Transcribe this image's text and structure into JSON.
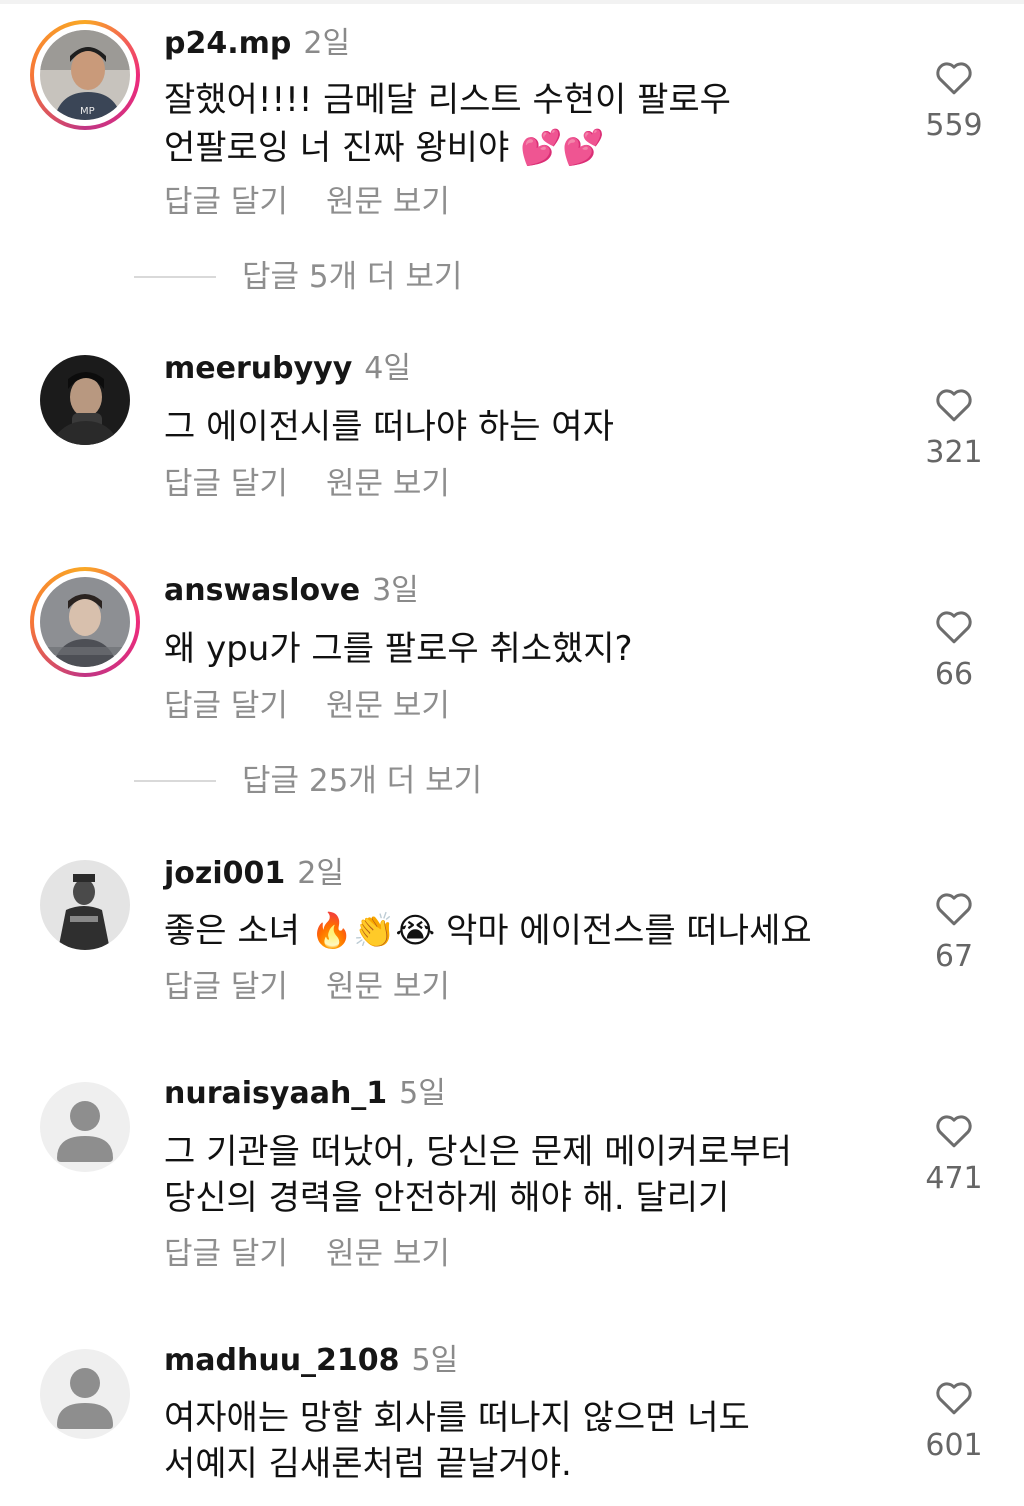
{
  "comments": [
    {
      "username": "p24.mp",
      "time": "2일",
      "lines": [
        "잘했어!!!! 금메달 리스트 수현이 팔로우",
        "언팔로잉 너 진짜 왕비야 💕💕"
      ],
      "likes": "559",
      "reply": "답글 달기",
      "see_original": "원문 보기",
      "more_replies": "답글 5개 더 보기",
      "avatar": "photo-person-ring"
    },
    {
      "username": "meerubyyy",
      "time": "4일",
      "lines": [
        "그 에이전시를 떠나야 하는 여자"
      ],
      "likes": "321",
      "reply": "답글 달기",
      "see_original": "원문 보기",
      "avatar": "photo-dark"
    },
    {
      "username": "answaslove",
      "time": "3일",
      "lines": [
        "왜 ypu가 그를 팔로우 취소했지?"
      ],
      "likes": "66",
      "reply": "답글 달기",
      "see_original": "원문 보기",
      "more_replies": "답글 25개 더 보기",
      "avatar": "photo-person-ring"
    },
    {
      "username": "jozi001",
      "time": "2일",
      "lines": [
        "좋은 소녀 🔥👏😭 악마 에이전스를 떠나세요"
      ],
      "likes": "67",
      "reply": "답글 달기",
      "see_original": "원문 보기",
      "avatar": "photo-grayscale"
    },
    {
      "username": "nuraisyaah_1",
      "time": "5일",
      "lines": [
        "그 기관을 떠났어, 당신은 문제 메이커로부터",
        "당신의 경력을 안전하게 해야 해. 달리기"
      ],
      "likes": "471",
      "reply": "답글 달기",
      "see_original": "원문 보기",
      "avatar": "default-user-icon"
    },
    {
      "username": "madhuu_2108",
      "time": "5일",
      "lines": [
        "여자애는 망할 회사를 떠나지 않으면 너도",
        "서예지 김새론처럼 끝날거야."
      ],
      "likes": "601",
      "avatar": "default-user-icon"
    }
  ],
  "colors": {
    "username": "#161616",
    "meta": "#8e8e8e",
    "text": "#111111",
    "ring_start": "#f9a825",
    "ring_end": "#ee2a7b"
  }
}
